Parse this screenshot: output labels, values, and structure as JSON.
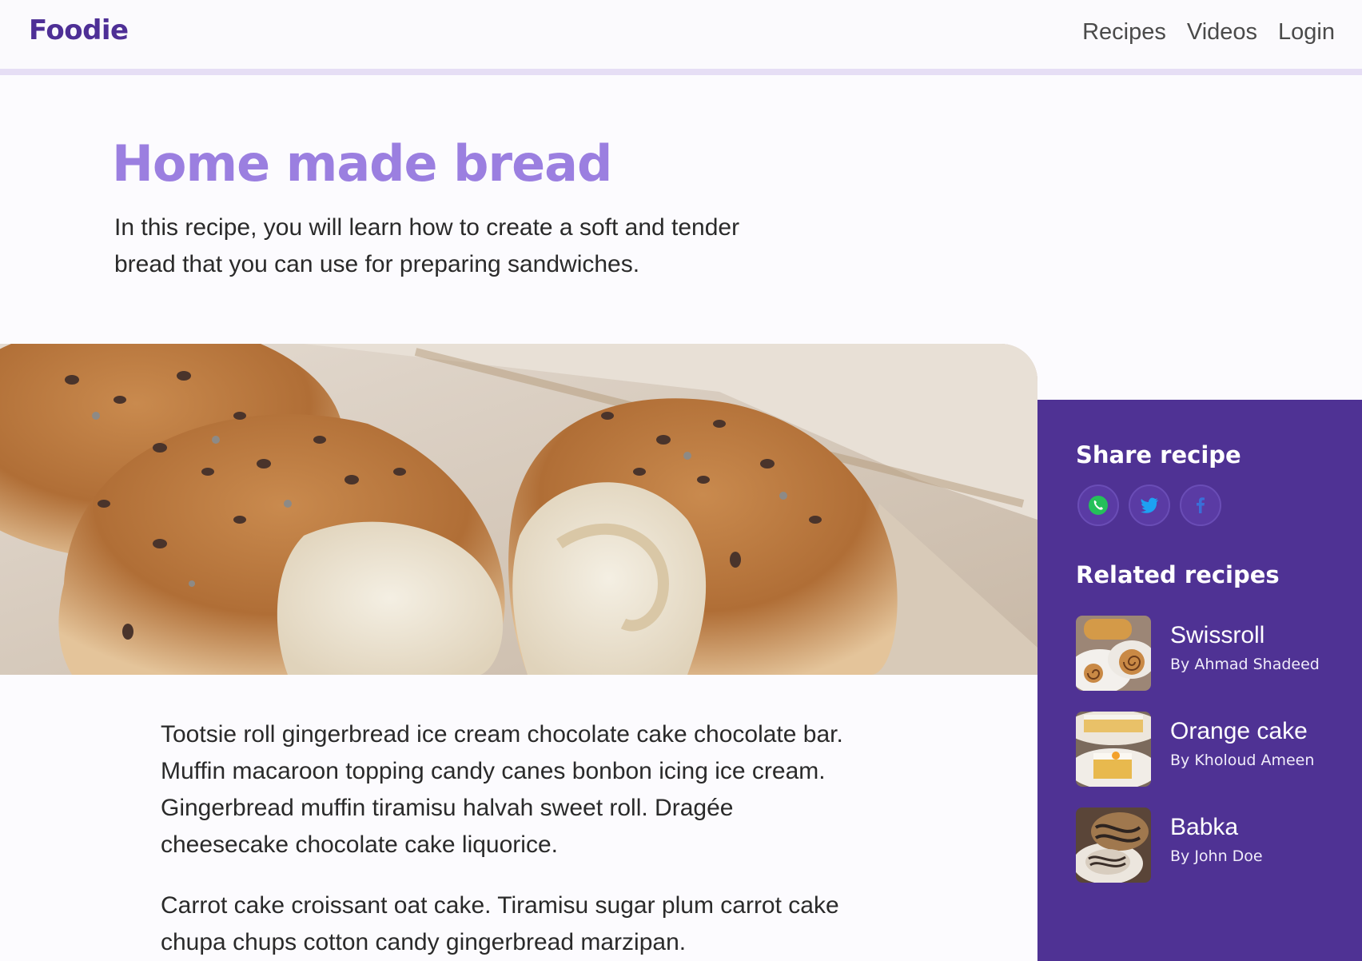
{
  "header": {
    "logo": "Foodie",
    "nav": [
      "Recipes",
      "Videos",
      "Login"
    ]
  },
  "recipe": {
    "title": "Home made bread",
    "intro": "In this recipe, you will learn how to create a soft and tender bread that you can use for preparing sandwiches.",
    "paragraphs": [
      "Tootsie roll gingerbread ice cream chocolate cake chocolate bar. Muffin macaroon topping candy canes bonbon icing ice cream. Gingerbread muffin tiramisu halvah sweet roll. Dragée cheesecake chocolate cake liquorice.",
      "Carrot cake croissant oat cake. Tiramisu sugar plum carrot cake chupa chups cotton candy gingerbread marzipan."
    ]
  },
  "sidebar": {
    "share_heading": "Share recipe",
    "share_icons": [
      "whatsapp-icon",
      "twitter-icon",
      "facebook-icon"
    ],
    "related_heading": "Related recipes",
    "related": [
      {
        "title": "Swissroll",
        "author": "By Ahmad Shadeed"
      },
      {
        "title": "Orange cake",
        "author": "By Kholoud Ameen"
      },
      {
        "title": "Babka",
        "author": "By John Doe"
      }
    ]
  },
  "colors": {
    "brand": "#4e2f96",
    "title": "#9b7fe0",
    "sidebar_bg": "#4f3294",
    "header_border": "#e6def5"
  }
}
